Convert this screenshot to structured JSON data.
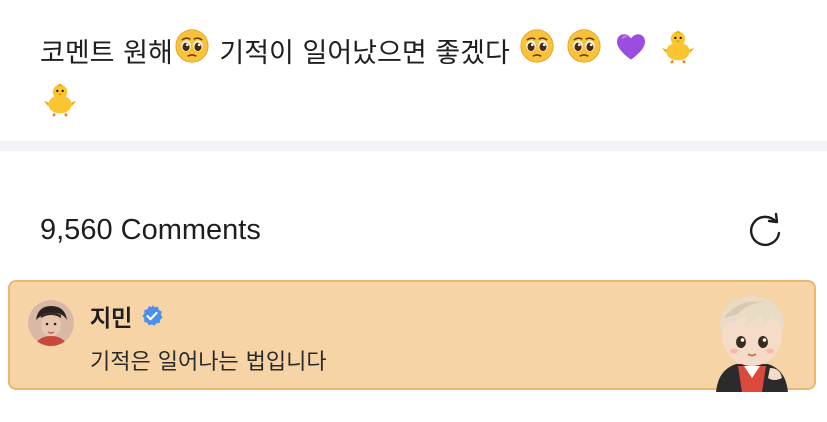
{
  "post": {
    "text_part1": "코멘트 원해",
    "text_part2": " 기적이 일어났으면 좋겠다"
  },
  "icons": {
    "pleading_face": "pleading-face-emoji",
    "purple_heart": "purple-heart-emoji",
    "baby_chick": "baby-chick-emoji",
    "refresh": "refresh-icon",
    "verified": "verified-badge-icon"
  },
  "comments": {
    "count_label": "9,560 Comments"
  },
  "pinned_comment": {
    "author": "지민",
    "verified": true,
    "body": "기적은 일어나는 법입니다"
  },
  "colors": {
    "card_bg": "#f6d4a6",
    "card_border": "#e8b872",
    "verified_blue": "#4a8ff0",
    "heart_purple": "#9b4de0",
    "chick_yellow": "#fbc531"
  }
}
